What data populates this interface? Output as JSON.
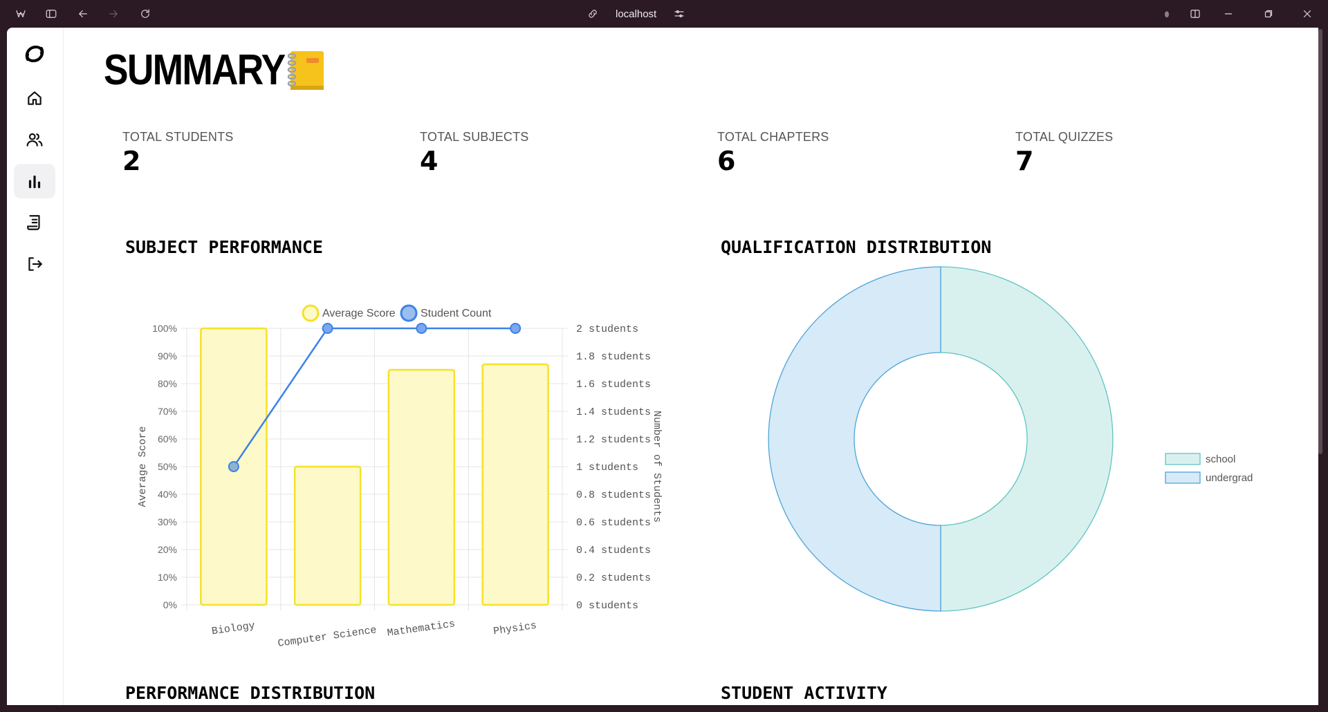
{
  "browser": {
    "url": "localhost"
  },
  "sidebar": {
    "items": [
      {
        "icon": "home-icon"
      },
      {
        "icon": "users-icon"
      },
      {
        "icon": "bar-chart-icon",
        "active": true
      },
      {
        "icon": "receipt-icon"
      },
      {
        "icon": "logout-icon"
      }
    ]
  },
  "page": {
    "title": "SUMMARY",
    "title_emoji": "notebook-emoji"
  },
  "stats": [
    {
      "label": "TOTAL STUDENTS",
      "value": "2"
    },
    {
      "label": "TOTAL SUBJECTS",
      "value": "4"
    },
    {
      "label": "TOTAL CHAPTERS",
      "value": "6"
    },
    {
      "label": "TOTAL QUIZZES",
      "value": "7"
    }
  ],
  "sections": {
    "subject_performance": "SUBJECT PERFORMANCE",
    "qualification_distribution": "QUALIFICATION DISTRIBUTION",
    "performance_distribution": "PERFORMANCE DISTRIBUTION",
    "student_activity": "STUDENT ACTIVITY"
  },
  "chart_data": [
    {
      "type": "bar",
      "categories": [
        "Biology",
        "Computer Science",
        "Mathematics",
        "Physics"
      ],
      "series": [
        {
          "name": "Average Score",
          "type": "bar",
          "axis": "left",
          "values": [
            100,
            50,
            85,
            87
          ],
          "color": "#f5e12a",
          "fill": "#fdf9c8"
        },
        {
          "name": "Student Count",
          "type": "line",
          "axis": "right",
          "values": [
            1,
            2,
            2,
            2
          ],
          "color": "#3b82e8"
        }
      ],
      "ylabel": "Average Score",
      "ylabel_right": "Number of Students",
      "ylim": [
        0,
        100
      ],
      "ylim_right": [
        0,
        2
      ],
      "yticks": [
        "0%",
        "10%",
        "20%",
        "30%",
        "40%",
        "50%",
        "60%",
        "70%",
        "80%",
        "90%",
        "100%"
      ],
      "yticks_right": [
        "0 students",
        "0.2 students",
        "0.4 students",
        "0.6 students",
        "0.8 students",
        "1 students",
        "1.2 students",
        "1.4 students",
        "1.6 students",
        "1.8 students",
        "2 students"
      ],
      "legend": "top",
      "grid": true
    },
    {
      "type": "pie",
      "variant": "doughnut",
      "labels": [
        "school",
        "undergrad"
      ],
      "values": [
        1,
        1
      ],
      "colors": [
        "#d8f1ef",
        "#d6eaf8"
      ],
      "borders": [
        "#5fc4c0",
        "#4ea3d8"
      ],
      "legend": "right"
    }
  ]
}
